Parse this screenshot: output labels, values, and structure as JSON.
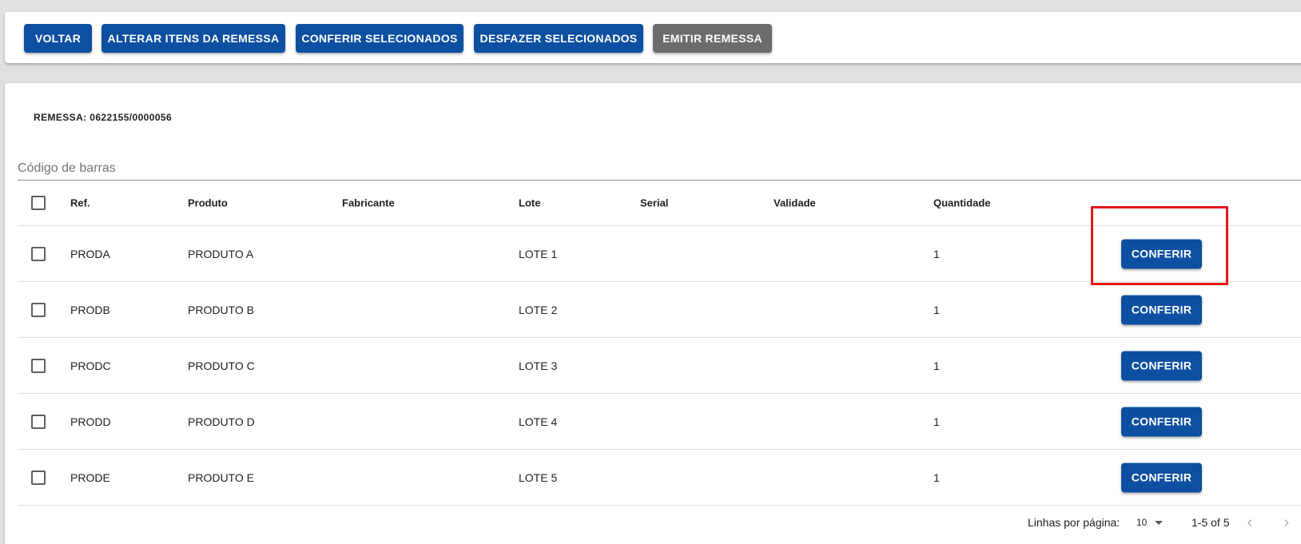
{
  "toolbar": {
    "buttons": {
      "back": "VOLTAR",
      "alter_items": "ALTERAR ITENS DA REMESSA",
      "check_selected": "CONFERIR SELECIONADOS",
      "undo_selected": "DESFAZER SELECIONADOS",
      "emit": "EMITIR REMESSA"
    }
  },
  "remessa": {
    "label": "REMESSA: 0622155/0000056"
  },
  "barcode": {
    "placeholder": "Código de barras",
    "value": ""
  },
  "table": {
    "columns": {
      "ref": "Ref.",
      "product": "Produto",
      "manufacturer": "Fabricante",
      "lot": "Lote",
      "serial": "Serial",
      "validity": "Validade",
      "quantity": "Quantidade"
    },
    "action_label": "CONFERIR",
    "rows": [
      {
        "ref": "PRODA",
        "product": "PRODUTO A",
        "manufacturer": "",
        "lot": "LOTE 1",
        "serial": "",
        "validity": "",
        "quantity": "1"
      },
      {
        "ref": "PRODB",
        "product": "PRODUTO B",
        "manufacturer": "",
        "lot": "LOTE 2",
        "serial": "",
        "validity": "",
        "quantity": "1"
      },
      {
        "ref": "PRODC",
        "product": "PRODUTO C",
        "manufacturer": "",
        "lot": "LOTE 3",
        "serial": "",
        "validity": "",
        "quantity": "1"
      },
      {
        "ref": "PRODD",
        "product": "PRODUTO D",
        "manufacturer": "",
        "lot": "LOTE 4",
        "serial": "",
        "validity": "",
        "quantity": "1"
      },
      {
        "ref": "PRODE",
        "product": "PRODUTO E",
        "manufacturer": "",
        "lot": "LOTE 5",
        "serial": "",
        "validity": "",
        "quantity": "1"
      }
    ]
  },
  "pagination": {
    "rows_per_page_label": "Linhas por página:",
    "rows_per_page_value": "10",
    "range": "1-5 of 5"
  },
  "icons": {
    "prev": "chevron-left-icon",
    "next": "chevron-right-icon",
    "dropdown": "caret-down-icon",
    "checkbox": "checkbox-unchecked-icon"
  },
  "colors": {
    "primary": "#0d4fa0",
    "disabled_button": "#6b6b6b",
    "highlight": "#e8141b"
  }
}
